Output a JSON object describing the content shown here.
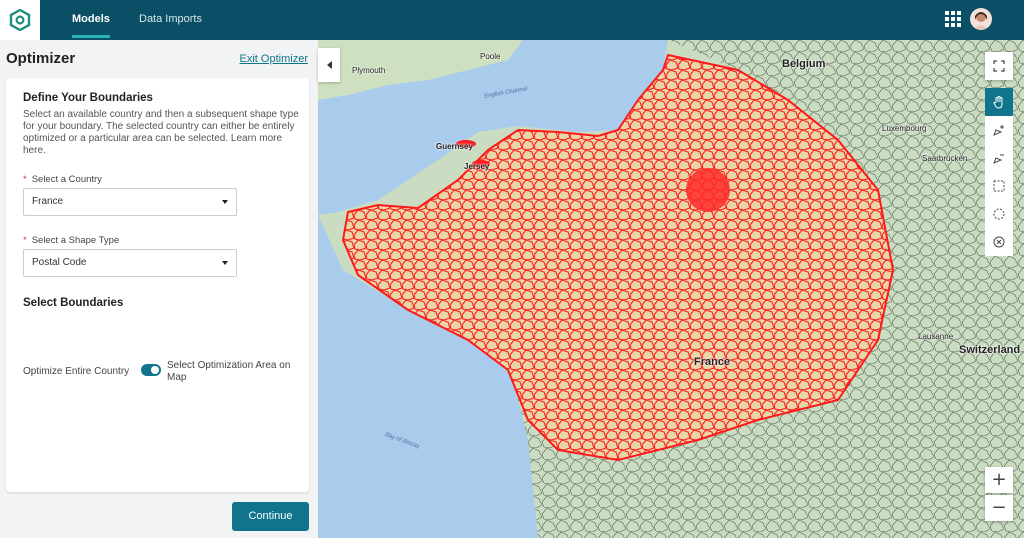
{
  "nav": {
    "tabs": [
      {
        "label": "Models",
        "active": true
      },
      {
        "label": "Data Imports",
        "active": false
      }
    ],
    "icons": {
      "logo": "app-logo-icon",
      "apps": "apps-grid-icon",
      "user": "user-avatar"
    }
  },
  "panel": {
    "title": "Optimizer",
    "exit_label": "Exit Optimizer",
    "boundaries_heading": "Define Your Boundaries",
    "description": "Select an available country and then a subsequent shape type for your boundary. The selected country can either be entirely optimized or a particular area can be selected. Learn more here.",
    "country": {
      "label": "Select a Country",
      "value": "France",
      "required": true
    },
    "shape_type": {
      "label": "Select a Shape Type",
      "value": "Postal Code",
      "required": true
    },
    "select_heading": "Select Boundaries",
    "toggle": {
      "left_label": "Optimize Entire Country",
      "right_label": "Select Optimization Area on Map",
      "state": "on"
    },
    "continue_label": "Continue"
  },
  "map": {
    "labels": {
      "belgium": "Belgium",
      "luxembourg": "Luxembourg",
      "saarbrucken": "Saarbrucken",
      "switzerland": "Switzerland",
      "lausanne": "Lausanne",
      "guernsey": "Guernsey",
      "jersey": "Jersey",
      "france": "France",
      "plymouth": "Plymouth",
      "poole": "Poole",
      "english_channel": "English Channel",
      "bay_of_biscay": "Bay of Biscay"
    },
    "tools": [
      "fullscreen-icon",
      "hand-pan-icon",
      "add-point-icon",
      "remove-point-icon",
      "rectangle-select-icon",
      "circle-select-icon",
      "clear-selection-icon"
    ],
    "zoom": {
      "in": "+",
      "out": "−"
    },
    "colors": {
      "highlight": "#ff1f1f",
      "land": "#c8dcc2",
      "sea": "#9fc5ec",
      "accent": "#10758c"
    }
  }
}
